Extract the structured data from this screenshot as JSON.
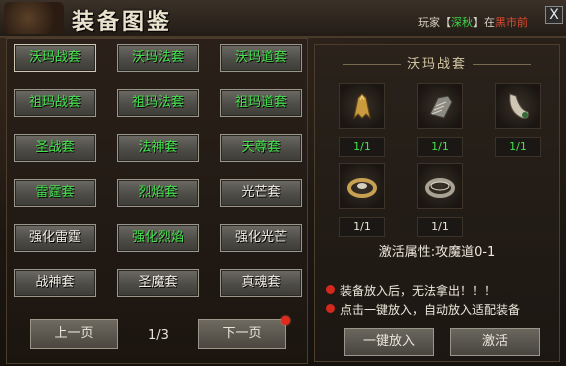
{
  "title": "装备图鉴",
  "notice": {
    "prefix": "玩家【",
    "player": "深秋",
    "mid": "】在",
    "location": "黑市前"
  },
  "close_label": "X",
  "sets": [
    {
      "label": "沃玛战套",
      "color": "green"
    },
    {
      "label": "沃玛法套",
      "color": "green"
    },
    {
      "label": "沃玛道套",
      "color": "green"
    },
    {
      "label": "祖玛战套",
      "color": "green"
    },
    {
      "label": "祖玛法套",
      "color": "green"
    },
    {
      "label": "祖玛道套",
      "color": "green"
    },
    {
      "label": "圣战套",
      "color": "green"
    },
    {
      "label": "法神套",
      "color": "green"
    },
    {
      "label": "天尊套",
      "color": "green"
    },
    {
      "label": "雷霆套",
      "color": "green"
    },
    {
      "label": "烈焰套",
      "color": "green"
    },
    {
      "label": "光芒套",
      "color": "white"
    },
    {
      "label": "强化雷霆",
      "color": "white"
    },
    {
      "label": "强化烈焰",
      "color": "green"
    },
    {
      "label": "强化光芒",
      "color": "white"
    },
    {
      "label": "战神套",
      "color": "white"
    },
    {
      "label": "圣魔套",
      "color": "white"
    },
    {
      "label": "真魂套",
      "color": "white"
    }
  ],
  "pagination": {
    "prev_label": "上一页",
    "next_label": "下一页",
    "current": "1/3"
  },
  "detail": {
    "set_name": "沃玛战套",
    "items": [
      {
        "icon": "helmet-icon",
        "count": "1/1"
      },
      {
        "icon": "bracer-icon",
        "count": "1/1"
      },
      {
        "icon": "necklace-icon",
        "count": "1/1"
      },
      {
        "icon": "ring-icon",
        "count": "1/1"
      },
      {
        "icon": "ring-icon",
        "count": "1/1"
      }
    ],
    "activate_attr": "激活属性:攻魔道0-1"
  },
  "info": {
    "line1": "装备放入后，无法拿出！！！",
    "line2": "点击一键放入，自动放入适配装备"
  },
  "actions": {
    "auto_place_label": "一键放入",
    "activate_label": "激活"
  },
  "colors": {
    "green_text": "#43e34d",
    "white_text": "#f0ece2",
    "red_dot": "#e02a1c"
  }
}
